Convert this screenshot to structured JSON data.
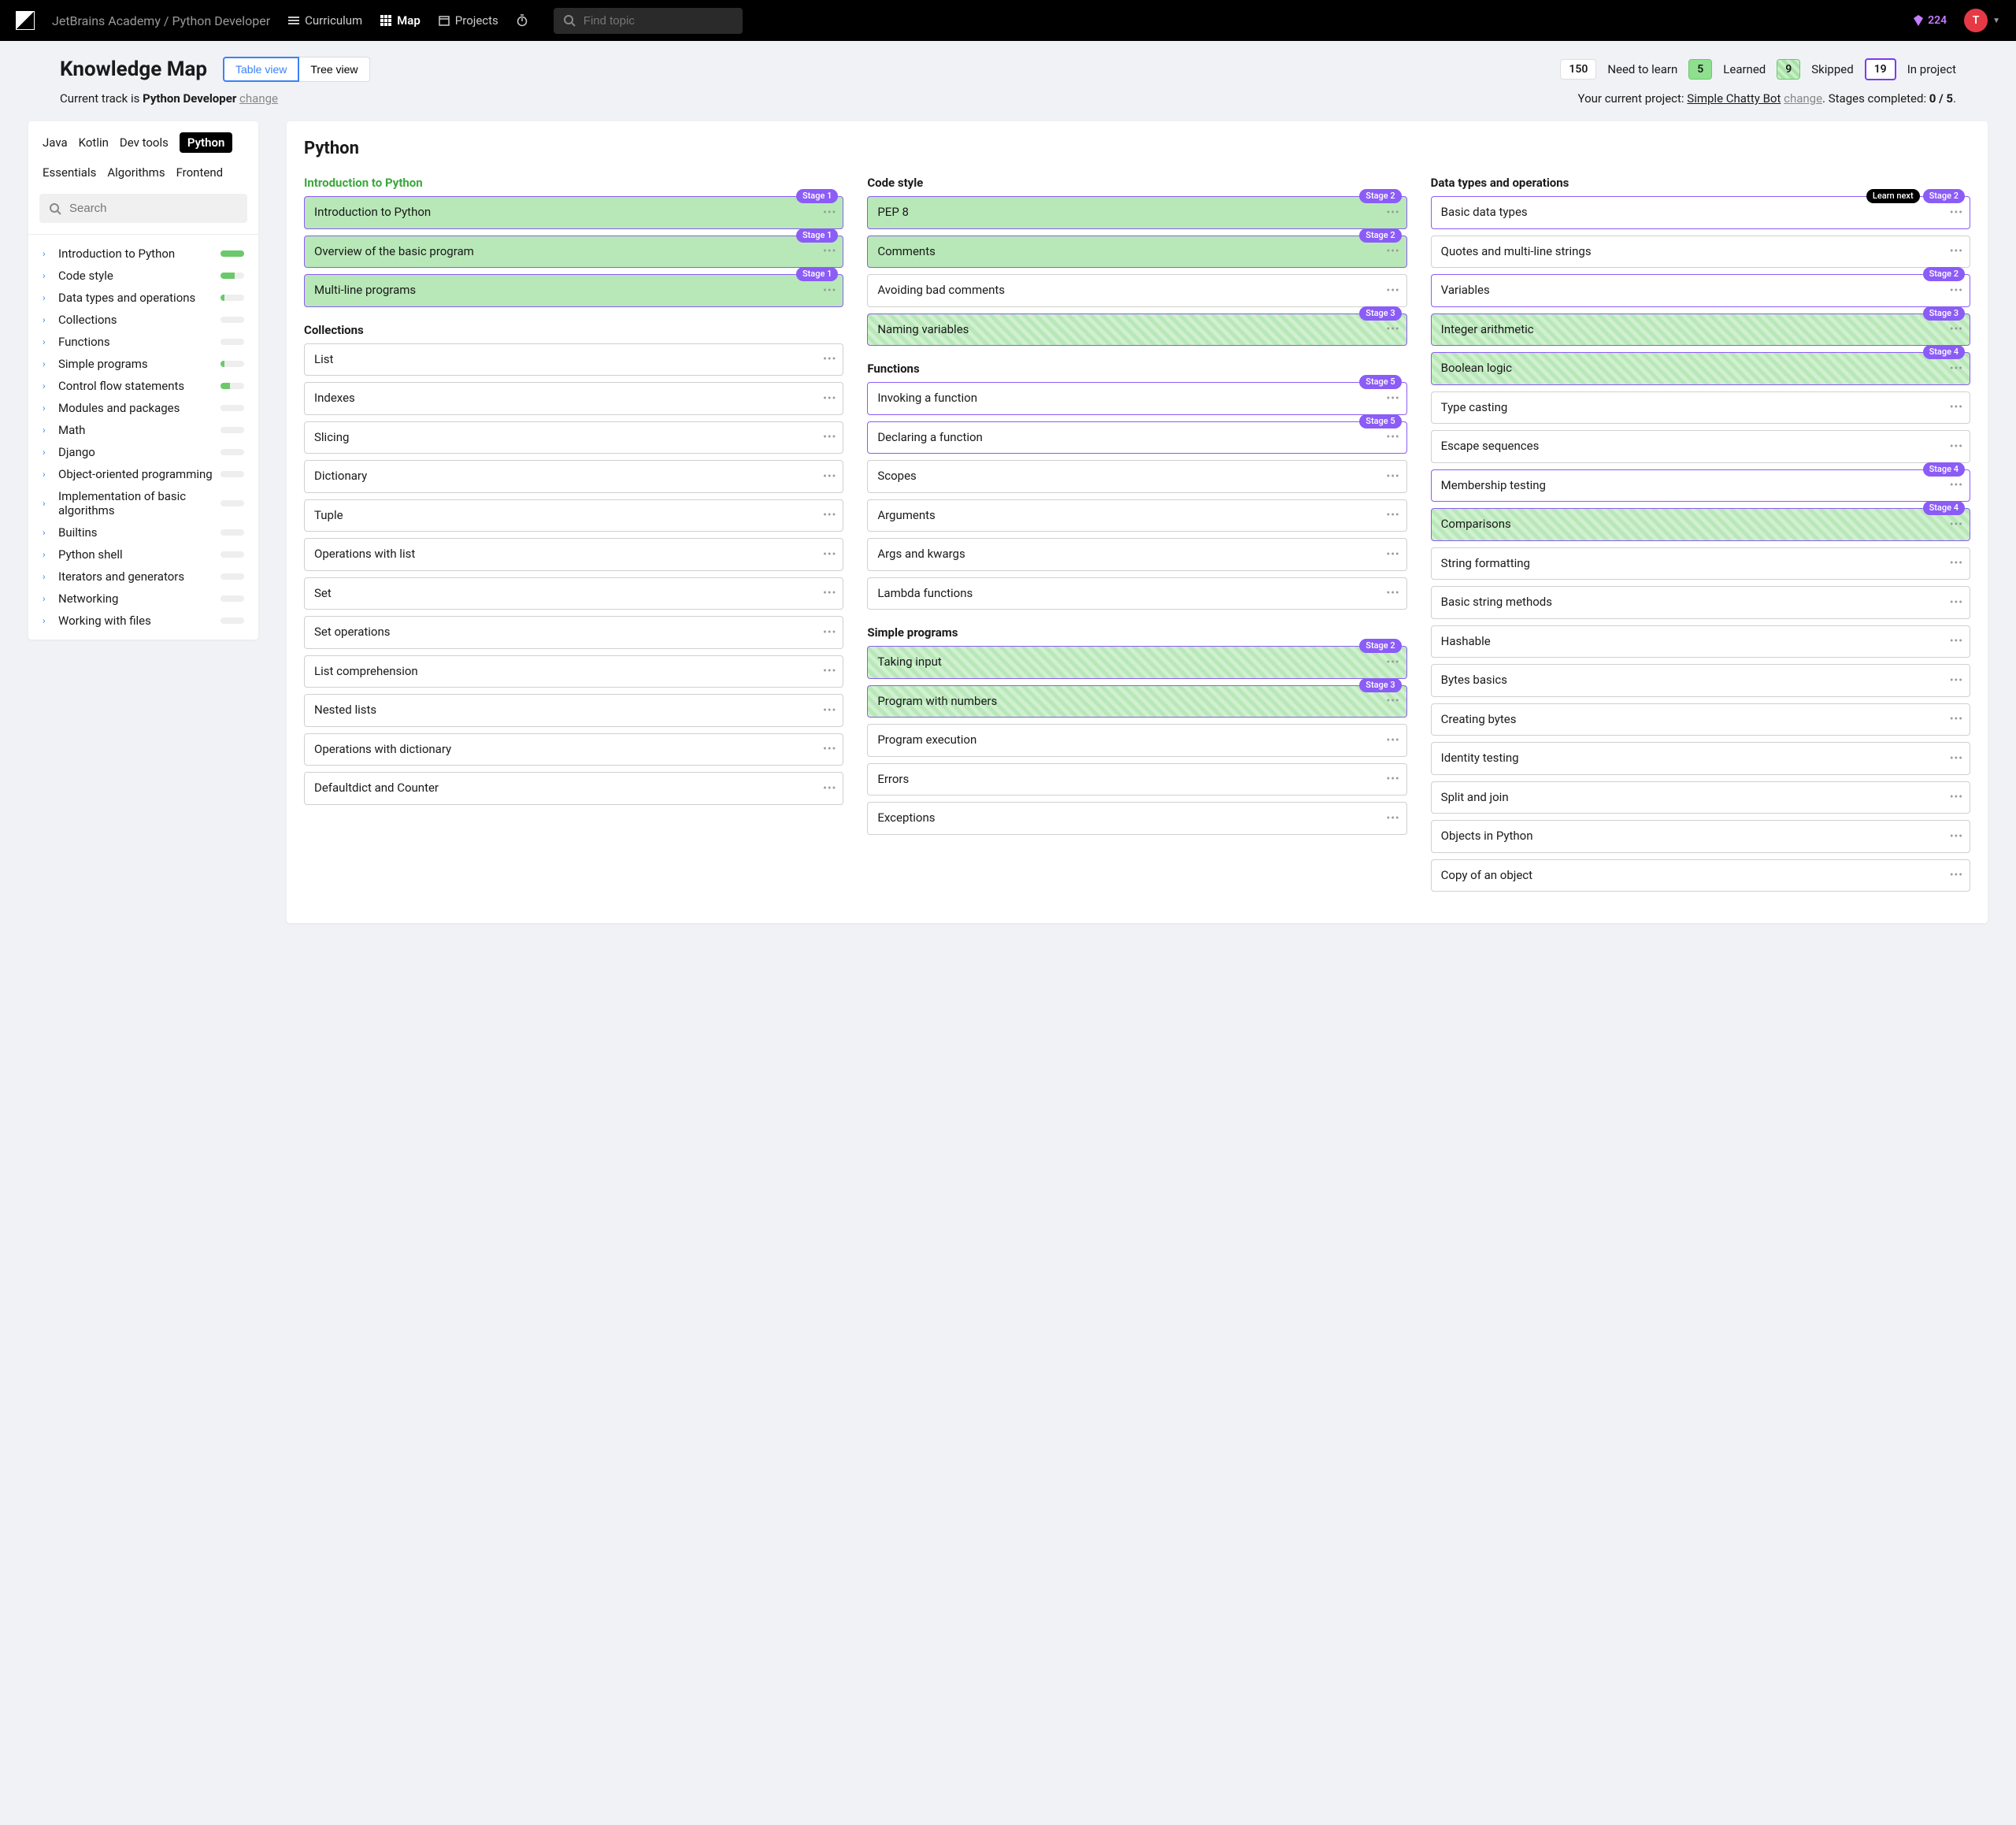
{
  "topbar": {
    "breadcrumb": "JetBrains Academy / Python Developer",
    "nav": {
      "curriculum": "Curriculum",
      "map": "Map",
      "projects": "Projects"
    },
    "search_placeholder": "Find topic",
    "gems": "224",
    "avatar_letter": "T"
  },
  "header": {
    "title": "Knowledge Map",
    "views": {
      "table": "Table view",
      "tree": "Tree view"
    },
    "stats": {
      "need_count": "150",
      "need_label": "Need to learn",
      "learned_count": "5",
      "learned_label": "Learned",
      "skipped_count": "9",
      "skipped_label": "Skipped",
      "inproject_count": "19",
      "inproject_label": "In project"
    }
  },
  "subheader": {
    "track_prefix": "Current track is ",
    "track_name": "Python Developer",
    "change": "change",
    "project_prefix": "Your current project: ",
    "project_name": "Simple Chatty Bot",
    "stages_prefix": ". Stages completed: ",
    "stages_done": "0 / 5",
    "stages_suffix": "."
  },
  "sidebar": {
    "tabs": [
      "Java",
      "Kotlin",
      "Dev tools",
      "Python",
      "Essentials",
      "Algorithms",
      "Frontend"
    ],
    "active_tab": "Python",
    "search_placeholder": "Search",
    "categories": [
      {
        "label": "Introduction to Python",
        "progress": 100
      },
      {
        "label": "Code style",
        "progress": 60
      },
      {
        "label": "Data types and operations",
        "progress": 15
      },
      {
        "label": "Collections",
        "progress": 0
      },
      {
        "label": "Functions",
        "progress": 0
      },
      {
        "label": "Simple programs",
        "progress": 15
      },
      {
        "label": "Control flow statements",
        "progress": 40
      },
      {
        "label": "Modules and packages",
        "progress": 0
      },
      {
        "label": "Math",
        "progress": 0
      },
      {
        "label": "Django",
        "progress": 0
      },
      {
        "label": "Object-oriented programming",
        "progress": 0
      },
      {
        "label": "Implementation of basic algorithms",
        "progress": 0
      },
      {
        "label": "Builtins",
        "progress": 0
      },
      {
        "label": "Python shell",
        "progress": 0
      },
      {
        "label": "Iterators and generators",
        "progress": 0
      },
      {
        "label": "Networking",
        "progress": 0
      },
      {
        "label": "Working with files",
        "progress": 0
      }
    ]
  },
  "content": {
    "title": "Python",
    "columns": [
      {
        "sections": [
          {
            "title": "Introduction to Python",
            "style": "learned",
            "cards": [
              {
                "label": "Introduction to Python",
                "state": "learned",
                "inproject": true,
                "badges": [
                  "Stage 1"
                ]
              },
              {
                "label": "Overview of the basic program",
                "state": "learned",
                "inproject": true,
                "badges": [
                  "Stage 1"
                ]
              },
              {
                "label": "Multi-line programs",
                "state": "learned",
                "inproject": true,
                "badges": [
                  "Stage 1"
                ]
              }
            ]
          },
          {
            "title": "Collections",
            "cards": [
              {
                "label": "List"
              },
              {
                "label": "Indexes"
              },
              {
                "label": "Slicing"
              },
              {
                "label": "Dictionary"
              },
              {
                "label": "Tuple"
              },
              {
                "label": "Operations with list"
              },
              {
                "label": "Set"
              },
              {
                "label": "Set operations"
              },
              {
                "label": "List comprehension"
              },
              {
                "label": "Nested lists"
              },
              {
                "label": "Operations with dictionary"
              },
              {
                "label": "Defaultdict and Counter"
              }
            ]
          }
        ]
      },
      {
        "sections": [
          {
            "title": "Code style",
            "cards": [
              {
                "label": "PEP 8",
                "state": "learned",
                "inproject": true,
                "badges": [
                  "Stage 2"
                ]
              },
              {
                "label": "Comments",
                "state": "learned",
                "inproject": true,
                "badges": [
                  "Stage 2"
                ]
              },
              {
                "label": "Avoiding bad comments"
              },
              {
                "label": "Naming variables",
                "state": "skipped",
                "inproject": true,
                "badges": [
                  "Stage 3"
                ]
              }
            ]
          },
          {
            "title": "Functions",
            "cards": [
              {
                "label": "Invoking a function",
                "inproject": true,
                "badges": [
                  "Stage 5"
                ]
              },
              {
                "label": "Declaring a function",
                "inproject": true,
                "badges": [
                  "Stage 5"
                ]
              },
              {
                "label": "Scopes"
              },
              {
                "label": "Arguments"
              },
              {
                "label": "Args and kwargs"
              },
              {
                "label": "Lambda functions"
              }
            ]
          },
          {
            "title": "Simple programs",
            "cards": [
              {
                "label": "Taking input",
                "state": "skipped",
                "inproject": true,
                "badges": [
                  "Stage 2"
                ]
              },
              {
                "label": "Program with numbers",
                "state": "skipped",
                "inproject": true,
                "badges": [
                  "Stage 3"
                ]
              },
              {
                "label": "Program execution"
              },
              {
                "label": "Errors"
              },
              {
                "label": "Exceptions"
              }
            ]
          }
        ]
      },
      {
        "sections": [
          {
            "title": "Data types and operations",
            "cards": [
              {
                "label": "Basic data types",
                "inproject": true,
                "badges": [
                  "Learn next",
                  "Stage 2"
                ],
                "badge_styles": [
                  "dark",
                  ""
                ]
              },
              {
                "label": "Quotes and multi-line strings"
              },
              {
                "label": "Variables",
                "inproject": true,
                "badges": [
                  "Stage 2"
                ]
              },
              {
                "label": "Integer arithmetic",
                "state": "skipped",
                "inproject": true,
                "badges": [
                  "Stage 3"
                ]
              },
              {
                "label": "Boolean logic",
                "state": "skipped",
                "inproject": true,
                "badges": [
                  "Stage 4"
                ]
              },
              {
                "label": "Type casting"
              },
              {
                "label": "Escape sequences"
              },
              {
                "label": "Membership testing",
                "inproject": true,
                "badges": [
                  "Stage 4"
                ]
              },
              {
                "label": "Comparisons",
                "state": "skipped",
                "inproject": true,
                "badges": [
                  "Stage 4"
                ]
              },
              {
                "label": "String formatting"
              },
              {
                "label": "Basic string methods"
              },
              {
                "label": "Hashable"
              },
              {
                "label": "Bytes basics"
              },
              {
                "label": "Creating bytes"
              },
              {
                "label": "Identity testing"
              },
              {
                "label": "Split and join"
              },
              {
                "label": "Objects in Python"
              },
              {
                "label": "Copy of an object"
              }
            ]
          }
        ]
      }
    ]
  }
}
